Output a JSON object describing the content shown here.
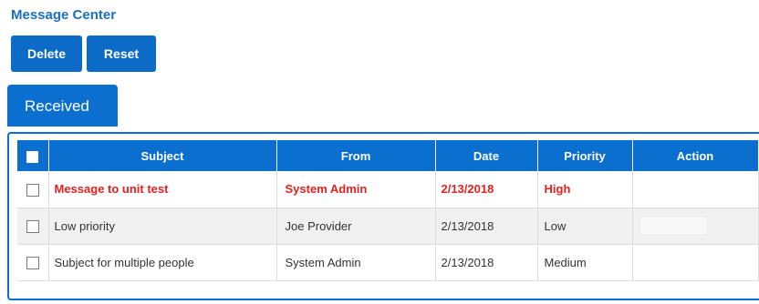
{
  "page_title": "Message Center",
  "toolbar": {
    "delete_label": "Delete",
    "reset_label": "Reset"
  },
  "tabs": [
    {
      "label": "Received",
      "active": true
    }
  ],
  "table": {
    "headers": {
      "subject": "Subject",
      "from": "From",
      "date": "Date",
      "priority": "Priority",
      "action": "Action"
    },
    "rows": [
      {
        "subject": "Message to unit test",
        "from": "System Admin",
        "date": "2/13/2018",
        "priority": "High",
        "unread": true
      },
      {
        "subject": "Low priority",
        "from": "Joe Provider",
        "date": "2/13/2018",
        "priority": "Low",
        "unread": false
      },
      {
        "subject": "Subject for multiple people",
        "from": "System Admin",
        "date": "2/13/2018",
        "priority": "Medium",
        "unread": false
      }
    ]
  },
  "colors": {
    "primary_blue": "#0b6fcf",
    "title_blue": "#1a6fc4",
    "unread_red": "#e61f1f"
  }
}
